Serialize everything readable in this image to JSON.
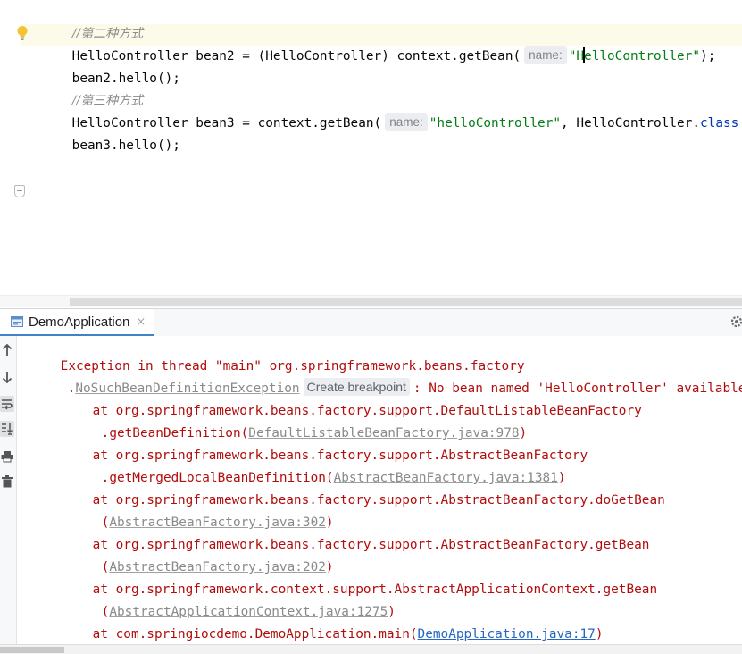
{
  "editor": {
    "lines": {
      "comment2": "//第二种方式",
      "line2_pre": "HelloController bean2 = (HelloController) context.getBean(",
      "line2_hint": "name:",
      "line2_str_a": "\"H",
      "line2_str_b": "elloController\"",
      "line2_post": ");",
      "line3": "bean2.hello();",
      "comment3": "//第三种方式",
      "line4_pre": "HelloController bean3 = context.getBean(",
      "line4_hint": "name:",
      "line4_str": "\"helloController\"",
      "line4_mid": ", HelloController.",
      "line4_kw": "class",
      "line5": "bean3.hello();"
    }
  },
  "run_panel": {
    "tab_label": "DemoApplication",
    "tab_close": "×",
    "console": {
      "l1": "Exception in thread \"main\" org.springframework.beans.factory",
      "l2_pre": ".",
      "l2_link": "NoSuchBeanDefinitionException",
      "l2_hint": "Create breakpoint",
      "l2_post": ": No bean named 'HelloController' available",
      "l3": "at org.springframework.beans.factory.support.DefaultListableBeanFactory",
      "l4_pre": ".getBeanDefinition(",
      "l4_link": "DefaultListableBeanFactory.java:978",
      "l4_post": ")",
      "l5": "at org.springframework.beans.factory.support.AbstractBeanFactory",
      "l6_pre": ".getMergedLocalBeanDefinition(",
      "l6_link": "AbstractBeanFactory.java:1381",
      "l6_post": ")",
      "l7": "at org.springframework.beans.factory.support.AbstractBeanFactory.doGetBean",
      "l8_pre": "(",
      "l8_link": "AbstractBeanFactory.java:302",
      "l8_post": ")",
      "l9": "at org.springframework.beans.factory.support.AbstractBeanFactory.getBean",
      "l10_pre": "(",
      "l10_link": "AbstractBeanFactory.java:202",
      "l10_post": ")",
      "l11": "at org.springframework.context.support.AbstractApplicationContext.getBean",
      "l12_pre": "(",
      "l12_link": "AbstractApplicationContext.java:1275",
      "l12_post": ")",
      "l13_pre": "at com.springiocdemo.DemoApplication.main(",
      "l13_link": "DemoApplication.java:17",
      "l13_post": ")"
    }
  },
  "icons": {
    "bulb": "lightbulb-icon",
    "fold": "fold-icon",
    "run_tab": "run-config-icon",
    "settings": "gear-icon",
    "up": "arrow-up-icon",
    "down": "arrow-down-icon",
    "wrap": "soft-wrap-icon",
    "scroll_end": "scroll-to-end-icon",
    "print": "print-icon",
    "trash": "trash-icon"
  },
  "colors": {
    "error_text": "#b20d0d",
    "string": "#067d17",
    "keyword": "#0033b3",
    "comment": "#8c8c8c",
    "link_blue": "#2468c4"
  }
}
